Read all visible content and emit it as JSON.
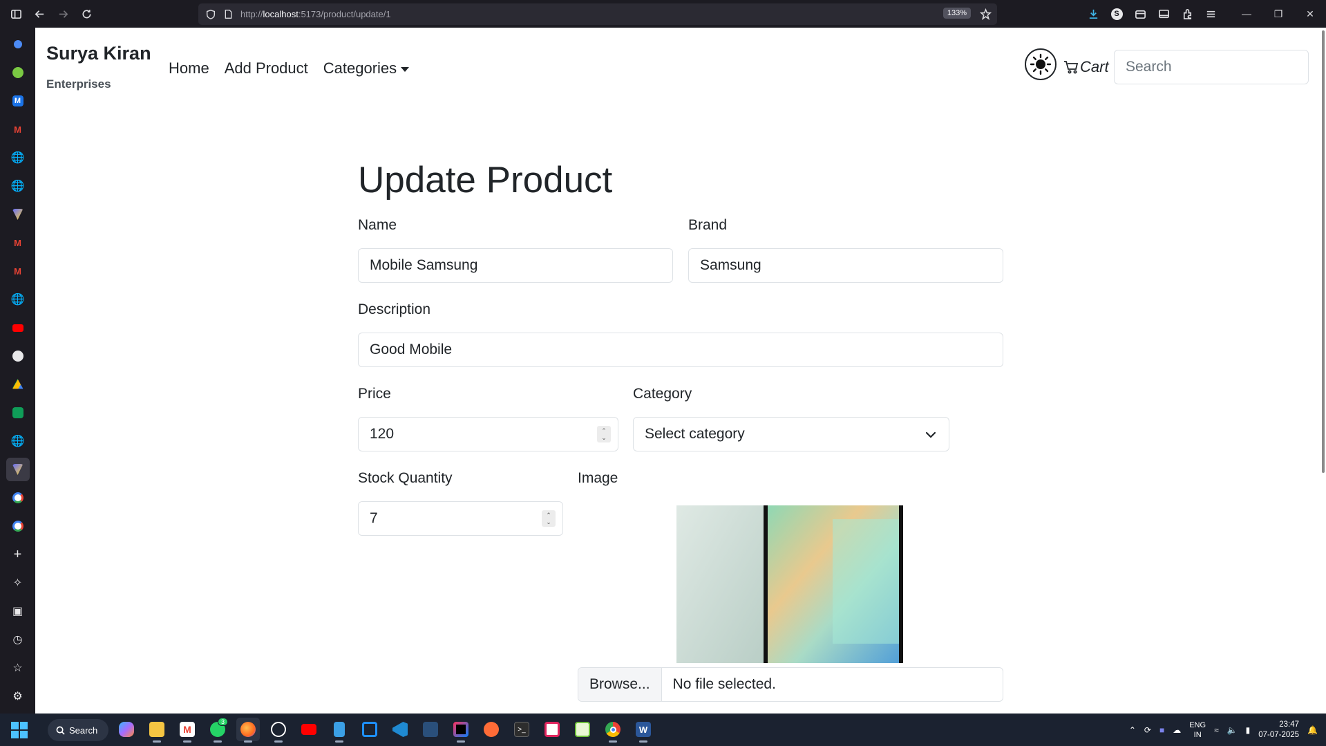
{
  "browser": {
    "url_prefix": "http://",
    "url_host": "localhost",
    "url_path": ":5173/product/update/1",
    "zoom": "133%"
  },
  "navbar": {
    "brand_title": "Surya Kiran",
    "brand_subtitle": "Enterprises",
    "links": [
      "Home",
      "Add Product",
      "Categories"
    ],
    "cart_label": "Cart",
    "search_placeholder": "Search"
  },
  "form": {
    "title": "Update Product",
    "name_label": "Name",
    "name_value": "Mobile Samsung",
    "brand_label": "Brand",
    "brand_value": "Samsung",
    "description_label": "Description",
    "description_value": "Good Mobile",
    "price_label": "Price",
    "price_value": "120",
    "category_label": "Category",
    "category_value": "Select category",
    "stock_label": "Stock Quantity",
    "stock_value": "7",
    "image_label": "Image",
    "file_button": "Browse...",
    "file_status": "No file selected."
  },
  "taskbar": {
    "search_label": "Search",
    "lang_line1": "ENG",
    "lang_line2": "IN",
    "time": "23:47",
    "date": "07-07-2025",
    "whatsapp_badge": "3"
  }
}
